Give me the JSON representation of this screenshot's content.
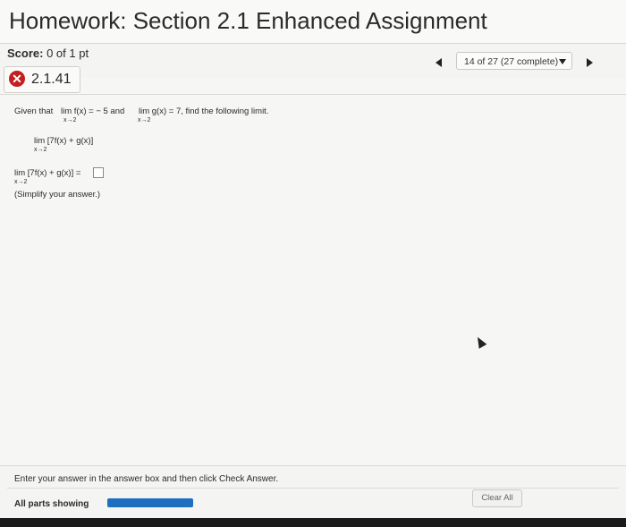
{
  "header": {
    "title": "Homework: Section 2.1 Enhanced Assignment"
  },
  "score": {
    "label": "Score:",
    "value": "0 of 1 pt"
  },
  "navigation": {
    "progress_text": "14 of 27 (27 complete)"
  },
  "question": {
    "id": "2.1.41",
    "status_icon": "x-circle-icon",
    "prompt_given": "Given that",
    "prompt_lim1": "lim f(x) = − 5 and",
    "prompt_lim2": "lim g(x) = 7, find the following limit.",
    "sub_x_to_2": "x→2",
    "target_expr": "lim [7f(x) + g(x)]",
    "answer_expr": "lim [7f(x) + g(x)] =",
    "hint": "(Simplify your answer.)",
    "answer_value": ""
  },
  "footer": {
    "instruction": "Enter your answer in the answer box and then click Check Answer.",
    "parts_label": "All parts showing",
    "clear_label": "Clear All"
  },
  "colors": {
    "accent": "#1f6fc0",
    "error": "#c21f1f"
  }
}
